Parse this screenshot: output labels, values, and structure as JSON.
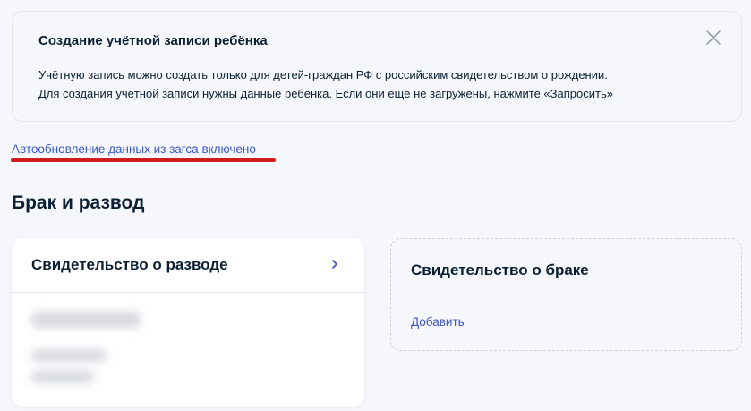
{
  "info": {
    "title": "Создание учётной записи ребёнка",
    "line1": "Учётную запись можно создать только для детей-граждан РФ с российским свидетельством о рождении.",
    "line2": "Для создания учётной записи нужны данные ребёнка. Если они ещё не загружены, нажмите «Запросить»",
    "close_icon": "close-icon"
  },
  "auto_update_link": "Автообновление данных из загса включено",
  "section_title": "Брак и развод",
  "divorce_card": {
    "title": "Свидетельство о разводе",
    "chevron_icon": "chevron-right-icon"
  },
  "marriage_card": {
    "title": "Свидетельство о браке",
    "add_label": "Добавить"
  },
  "colors": {
    "link": "#3b56c7",
    "highlight": "#d11a1a",
    "text": "#0b1f33",
    "background": "#f5f7fc"
  }
}
